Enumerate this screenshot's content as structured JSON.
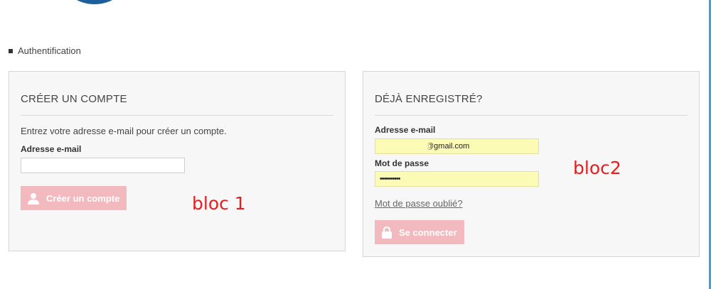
{
  "breadcrumb": {
    "current": "Authentification"
  },
  "create": {
    "title": "CRÉER UN COMPTE",
    "intro": "Entrez votre adresse e-mail pour créer un compte.",
    "email_label": "Adresse e-mail",
    "email_value": "",
    "button_label": "Créer un compte"
  },
  "login": {
    "title": "DÉJÀ ENREGISTRÉ?",
    "email_label": "Adresse e-mail",
    "email_value": "@gmail.com",
    "password_label": "Mot de passe",
    "password_value": "••••••••••",
    "forgot_label": "Mot de passe oublié?",
    "button_label": "Se connecter"
  },
  "annotations": {
    "bloc1": "bloc 1",
    "bloc2": "bloc2"
  },
  "colors": {
    "button": "#f2b9bf",
    "autofill": "#fbfbb6",
    "annotation": "#e51e1e",
    "logo": "#1c5f9c"
  },
  "icons": {
    "create_button": "user-icon",
    "login_button": "lock-icon"
  }
}
